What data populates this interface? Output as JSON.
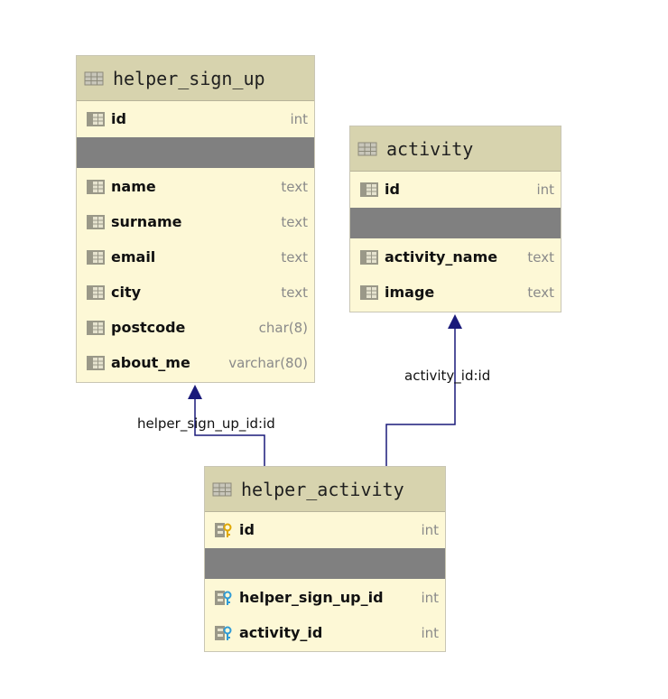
{
  "tables": {
    "helper_sign_up": {
      "title": "helper_sign_up",
      "columns": [
        {
          "name": "id",
          "type": "int"
        },
        {
          "name": "name",
          "type": "text"
        },
        {
          "name": "surname",
          "type": "text"
        },
        {
          "name": "email",
          "type": "text"
        },
        {
          "name": "city",
          "type": "text"
        },
        {
          "name": "postcode",
          "type": "char(8)"
        },
        {
          "name": "about_me",
          "type": "varchar(80)"
        }
      ]
    },
    "activity": {
      "title": "activity",
      "columns": [
        {
          "name": "id",
          "type": "int"
        },
        {
          "name": "activity_name",
          "type": "text"
        },
        {
          "name": "image",
          "type": "text"
        }
      ]
    },
    "helper_activity": {
      "title": "helper_activity",
      "columns": [
        {
          "name": "id",
          "type": "int"
        },
        {
          "name": "helper_sign_up_id",
          "type": "int"
        },
        {
          "name": "activity_id",
          "type": "int"
        }
      ]
    }
  },
  "relations": {
    "helper_sign_up_fk": "helper_sign_up_id:id",
    "activity_fk": "activity_id:id"
  },
  "colors": {
    "header": "#d7d3ae",
    "body": "#fdf8d6",
    "separator": "#808080",
    "connector": "#1a1a7a"
  }
}
